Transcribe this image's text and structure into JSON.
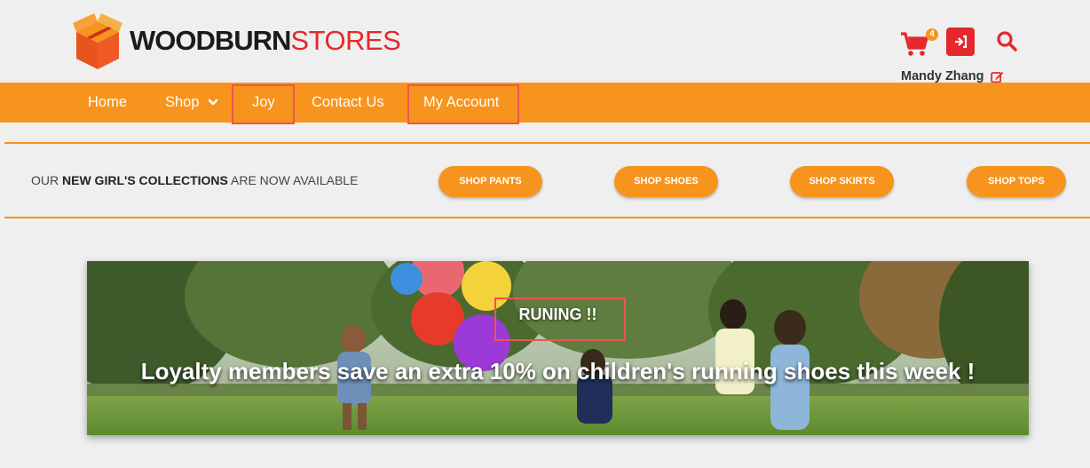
{
  "brand": {
    "name_bold": "WOODBURN",
    "name_light": "STORES"
  },
  "header": {
    "cart_count": "4",
    "user_name": "Mandy Zhang",
    "icons": {
      "cart": "cart-icon",
      "logout": "logout-icon",
      "search": "search-icon",
      "edit": "edit-icon"
    }
  },
  "nav": {
    "items": [
      {
        "label": "Home"
      },
      {
        "label": "Shop"
      },
      {
        "label": "Joy"
      },
      {
        "label": "Contact Us"
      },
      {
        "label": "My Account"
      }
    ]
  },
  "promo": {
    "text_prefix": "OUR ",
    "text_bold": "NEW GIRL'S COLLECTIONS",
    "text_suffix": " ARE NOW AVAILABLE",
    "buttons": [
      {
        "label": "SHOP PANTS"
      },
      {
        "label": "SHOP SHOES"
      },
      {
        "label": "SHOP SKIRTS"
      },
      {
        "label": "SHOP TOPS"
      }
    ]
  },
  "hero": {
    "tag": "RUNING !!",
    "headline": "Loyalty members save an extra 10% on children's running shoes this week !"
  },
  "colors": {
    "accent": "#f7941d",
    "brand_red": "#e4282c",
    "highlight": "#ed5450"
  }
}
